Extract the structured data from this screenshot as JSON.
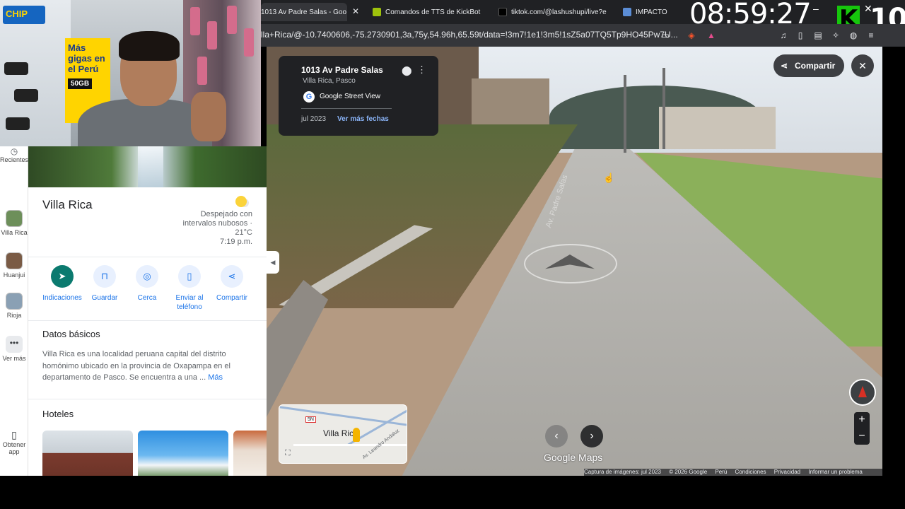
{
  "overlay": {
    "clock": "08:59:27",
    "kick_logo": "K",
    "counter": "10",
    "webcam": {
      "sign_text": "CHIP",
      "poster_text": "Más gigas en el Perú",
      "poster_badge": "50GB"
    }
  },
  "browser": {
    "tabs": [
      {
        "label": "1013 Av Padre Salas - Goo",
        "icon": "maps-icon",
        "color": "#ea4335"
      },
      {
        "label": "Comandos de TTS de KickBot",
        "icon": "kickbot-icon",
        "color": "#9ec20c"
      },
      {
        "label": "tiktok.com/@lashushupi/live?e",
        "icon": "tiktok-icon",
        "color": "#000000"
      },
      {
        "label": "IMPACTO",
        "icon": "doc-icon",
        "color": "#5b8dd6"
      }
    ],
    "url": "lla+Rica/@-10.7400606,-75.2730901,3a,75y,54.96h,65.59t/data=!3m7!1e1!3m5!1sZ5a07TQ5Tp9HO45Pw7U..."
  },
  "rail": {
    "items": [
      {
        "label": "Recientes",
        "icon": "history-icon"
      },
      {
        "label": "Villa Rica",
        "icon": "place-thumb"
      },
      {
        "label": "Huanjui",
        "icon": "place-thumb"
      },
      {
        "label": "Rioja",
        "icon": "place-thumb"
      },
      {
        "label": "Ver más",
        "icon": "more-icon"
      },
      {
        "label": "Obtener app",
        "icon": "phone-icon"
      }
    ]
  },
  "place": {
    "title": "Villa Rica",
    "weather_line1": "Despejado con",
    "weather_line2": "intervalos nubosos ·",
    "weather_temp": "21°C",
    "weather_time": "7:19 p.m.",
    "actions": [
      {
        "label": "Indicaciones",
        "icon": "directions-icon",
        "glyph": "➤"
      },
      {
        "label": "Guardar",
        "icon": "bookmark-icon",
        "glyph": "⊓"
      },
      {
        "label": "Cerca",
        "icon": "nearby-icon",
        "glyph": "◎"
      },
      {
        "label": "Enviar al teléfono",
        "icon": "send-to-phone-icon",
        "glyph": "▯"
      },
      {
        "label": "Compartir",
        "icon": "share-icon",
        "glyph": "⋖"
      }
    ],
    "basics_heading": "Datos básicos",
    "basics_text": "Villa Rica es una localidad peruana capital del distrito homónimo ubicado en la provincia de Oxapampa en el departamento de Pasco. Se encuentra a una ...",
    "basics_more": "Más",
    "hotels_heading": "Hoteles"
  },
  "streetview": {
    "card": {
      "title": "1013 Av Padre Salas",
      "subtitle": "Villa Rica, Pasco",
      "source": "Google Street View",
      "date": "jul 2023",
      "more_dates": "Ver más fechas"
    },
    "share_label": "Compartir",
    "road_label": "Av. Padre Salas",
    "minimap": {
      "town": "Villa Rica",
      "route": "5N",
      "street": "Av. Leandro Andaluz"
    },
    "logo": "Google Maps",
    "footer": [
      "Captura de imágenes: jul 2023",
      "© 2026 Google",
      "Perú",
      "Condiciones",
      "Privacidad",
      "Informar un problema"
    ]
  }
}
